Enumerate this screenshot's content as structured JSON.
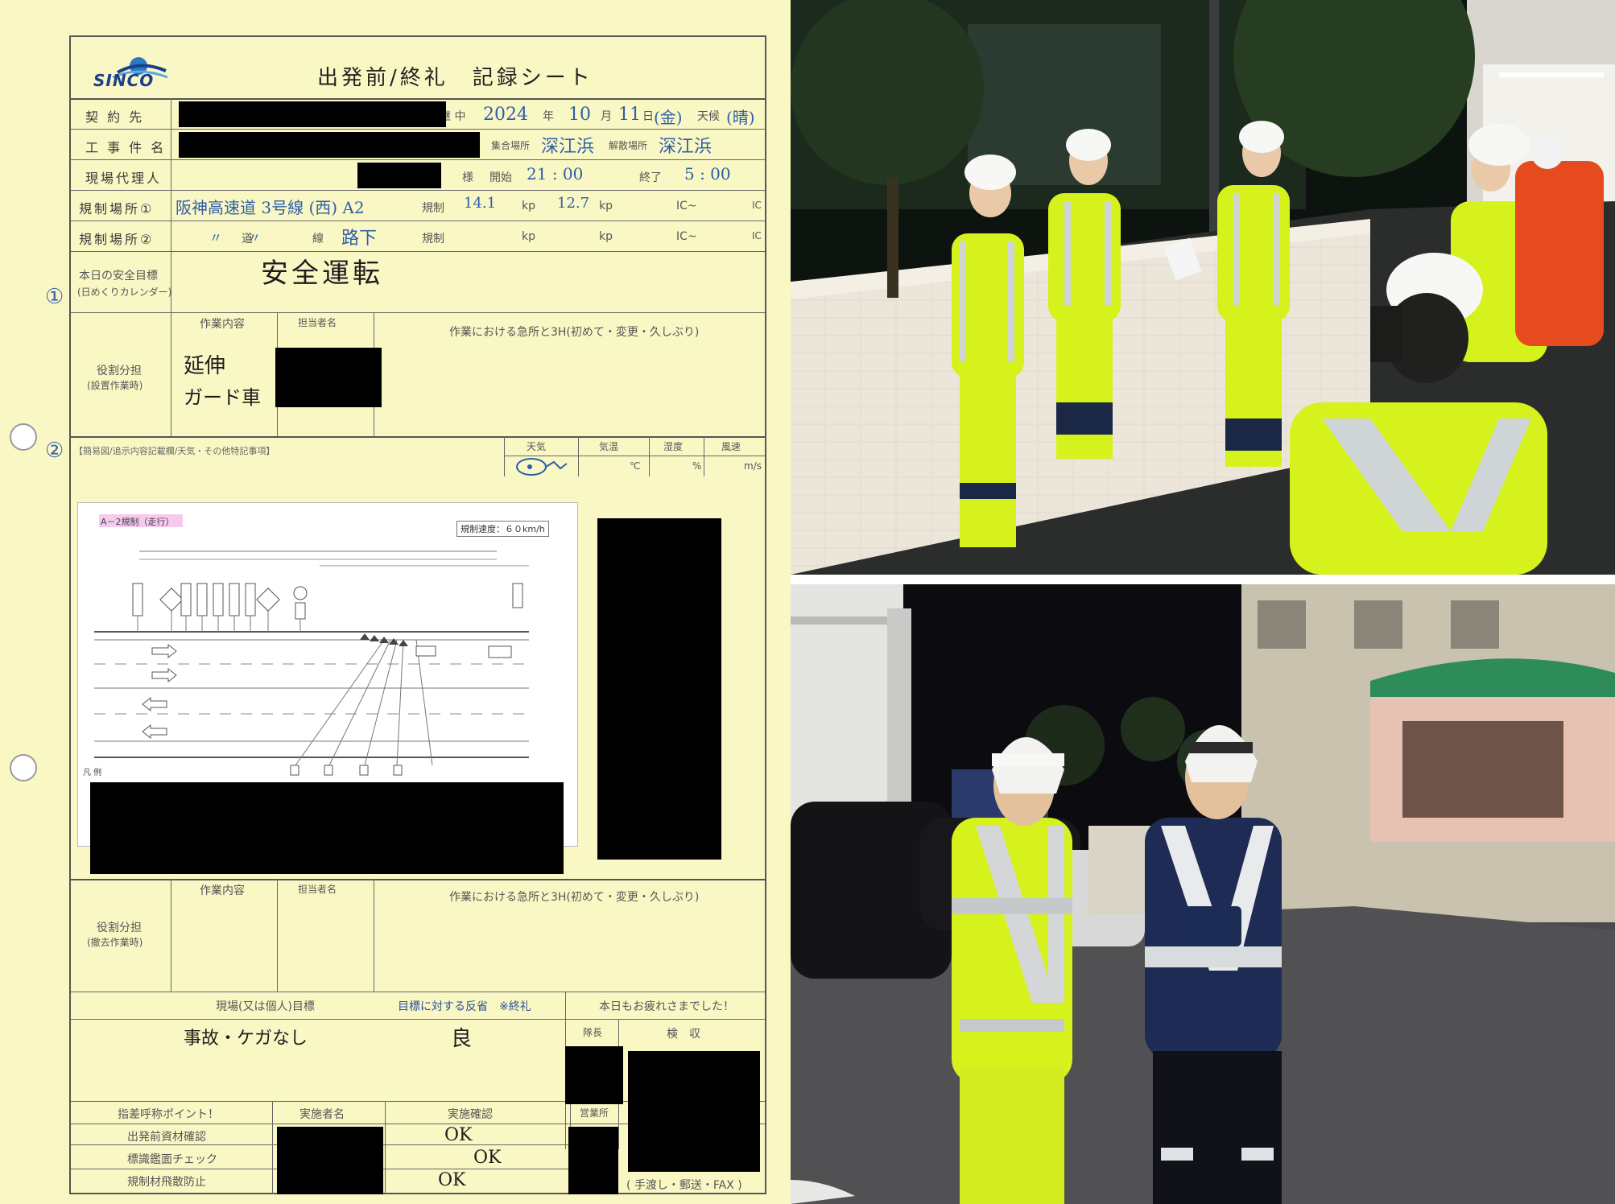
{
  "document": {
    "logo": "SINCO",
    "title": "出発前/終礼　記録シート",
    "labels": {
      "contractor": "契 約 先",
      "project": "工 事 件 名",
      "site_agent": "現場代理人",
      "sama": "様",
      "regulation_1": "規制場所①",
      "regulation_2": "規制場所②",
      "safety_goal": "本日の安全目標",
      "safety_goal_sub": "(日めくりカレンダー)",
      "role_setup": "役割分担",
      "role_setup_sub": "(設置作業時)",
      "role_removal": "役割分担",
      "role_removal_sub": "(撤去作業時)",
      "work_content": "作業内容",
      "person_in_charge": "担当者名",
      "key_points": "作業における急所と3H(初めて・変更・久しぶり)",
      "diagram_section": "【簡易図/追示内容記載欄/天気・その他特記事項】",
      "weather": "天気",
      "temperature": "気温",
      "humidity": "湿度",
      "wind": "風速",
      "temp_unit": "℃",
      "humidity_unit": "%",
      "wind_unit": "m/s",
      "site_goal": "現場(又は個人)目標",
      "reflection": "目標に対する反省　※終礼",
      "thanks": "本日もお疲れさまでした！",
      "leader": "隊長",
      "inspection": "検　収",
      "pointing_call": "指差呼称ポイント！",
      "implementer": "実施者名",
      "confirmation": "実施確認",
      "office": "営業所",
      "check_1": "出発前資材確認",
      "check_2": "標識鑑面チェック",
      "check_3": "規制材飛散防止",
      "delivery": "( 手渡し・郵送・FAX )",
      "in_progress": "継 中",
      "year_unit": "年",
      "month_unit": "月",
      "day_unit": "日",
      "weather_label": "天候",
      "meeting_place": "集合場所",
      "dismiss_place": "解散場所",
      "start": "開始",
      "end": "終了",
      "regulation": "規制",
      "kp": "kp",
      "ic": "IC~",
      "ic_end": "IC",
      "road": "道",
      "line": "線"
    },
    "handwritten": {
      "date_year": "2024",
      "date_month": "10",
      "date_day": "11",
      "day_of_week": "(金)",
      "weather": "(晴)",
      "meeting_place": "深江浜",
      "dismiss_place": "深江浜",
      "start_time": "21 : 00",
      "end_time": "5 : 00",
      "route_1": "阪神高速道 3号線 (西) A2",
      "kp_from": "14.1",
      "kp_to": "12.7",
      "route_2_marks": "〃　　〃",
      "route_2_dir": "路下",
      "safety_goal": "安全運転",
      "role_1": "延伸",
      "role_2": "ガード車",
      "site_goal": "事故・ケガなし",
      "reflection": "良",
      "ok_1": "OK",
      "ok_2": "OK",
      "ok_3": "OK",
      "circle_1": "①",
      "circle_2": "②"
    },
    "diagram": {
      "tag": "A－2規制（走行）",
      "speed": "規制速度：６０km/h",
      "legend": "凡 例"
    }
  }
}
